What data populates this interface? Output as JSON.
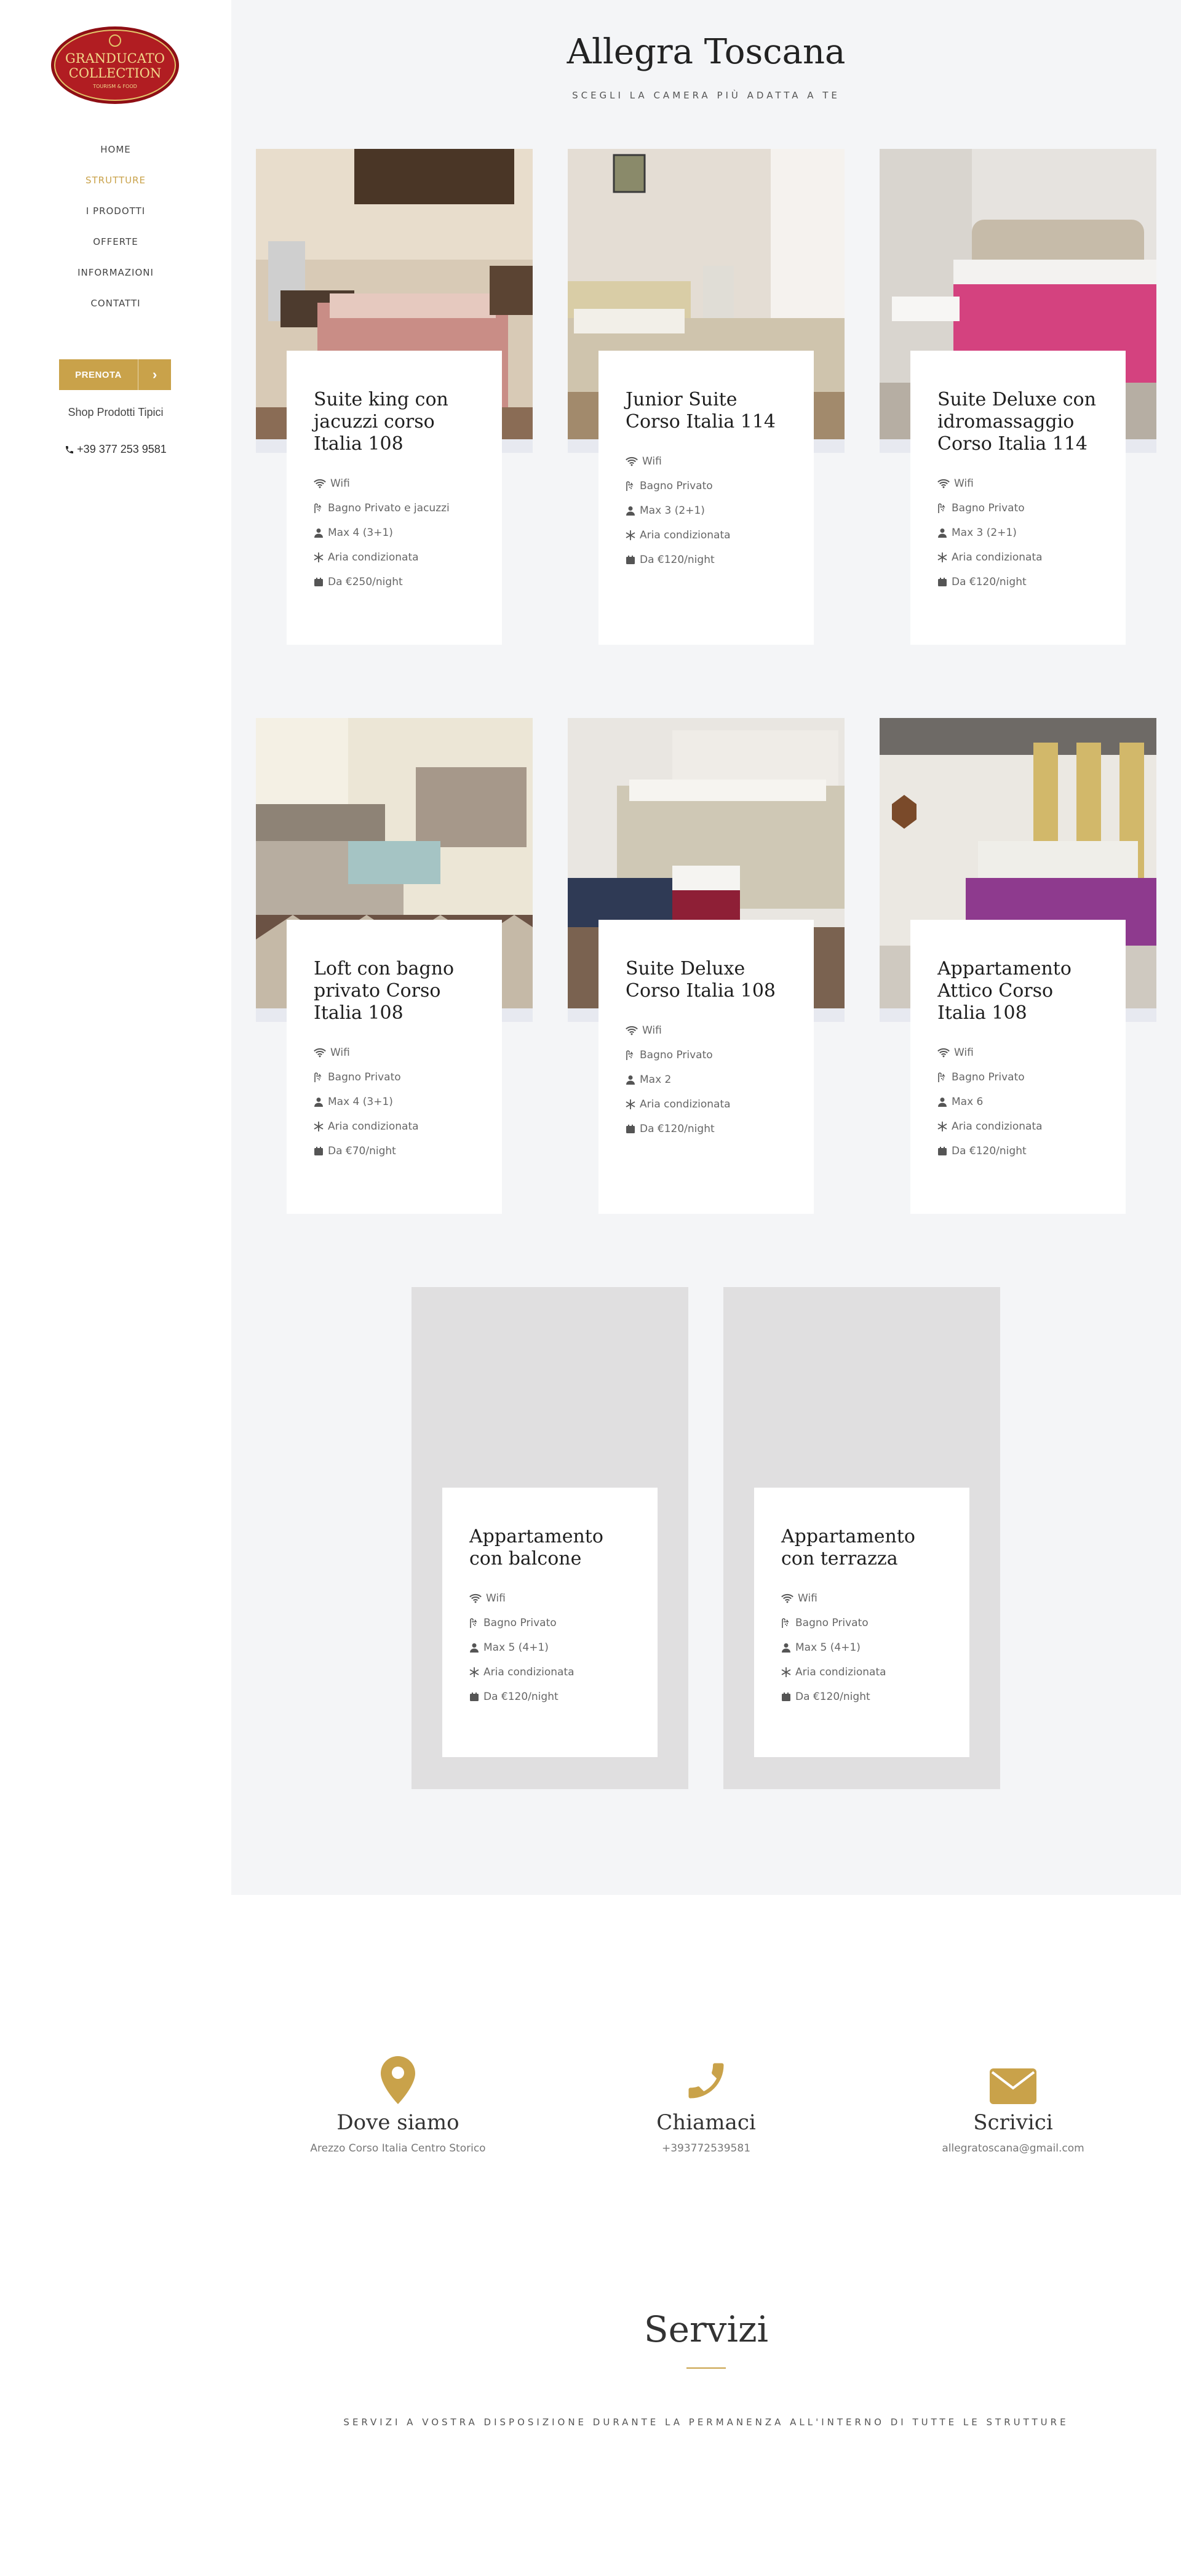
{
  "logo": {
    "line1": "GRANDUCATO",
    "line2": "COLLECTION",
    "line3": "TOURISM & FOOD"
  },
  "nav": {
    "items": [
      {
        "label": "HOME"
      },
      {
        "label": "STRUTTURE",
        "active": true
      },
      {
        "label": "I PRODOTTI"
      },
      {
        "label": "OFFERTE"
      },
      {
        "label": "INFORMAZIONI"
      },
      {
        "label": "CONTATTI"
      }
    ]
  },
  "prenota": {
    "label": "PRENOTA",
    "arrow": "›"
  },
  "shop": {
    "label": "Shop Prodotti Tipici"
  },
  "phone": {
    "number": "+39 377 253 9581"
  },
  "page": {
    "title": "Allegra Toscana",
    "subtitle": "SCEGLI LA CAMERA PIÙ ADATTA A TE"
  },
  "rooms": [
    {
      "title": "Suite king con jacuzzi corso Italia 108",
      "wifi": "Wifi",
      "bath": "Bagno Privato e jacuzzi",
      "guests": "Max 4 (3+1)",
      "air": "Aria condizionata",
      "price": "Da €250/night"
    },
    {
      "title": "Junior Suite Corso Italia 114",
      "wifi": "Wifi",
      "bath": "Bagno Privato",
      "guests": "Max 3 (2+1)",
      "air": "Aria condizionata",
      "price": "Da €120/night"
    },
    {
      "title": "Suite Deluxe con idromassaggio Corso Italia 114",
      "wifi": "Wifi",
      "bath": "Bagno Privato",
      "guests": "Max 3 (2+1)",
      "air": "Aria condizionata",
      "price": "Da €120/night"
    },
    {
      "title": "Loft con bagno privato Corso Italia 108",
      "wifi": "Wifi",
      "bath": "Bagno Privato",
      "guests": "Max 4 (3+1)",
      "air": "Aria condizionata",
      "price": "Da €70/night"
    },
    {
      "title": "Suite Deluxe Corso Italia 108",
      "wifi": "Wifi",
      "bath": "Bagno Privato",
      "guests": "Max 2",
      "air": "Aria condizionata",
      "price": "Da €120/night"
    },
    {
      "title": "Appartamento Attico Corso Italia 108",
      "wifi": "Wifi",
      "bath": "Bagno Privato",
      "guests": "Max 6",
      "air": "Aria condizionata",
      "price": "Da €120/night"
    },
    {
      "title": "Appartamento con balcone",
      "wifi": "Wifi",
      "bath": "Bagno Privato",
      "guests": "Max 5 (4+1)",
      "air": "Aria condizionata",
      "price": "Da €120/night"
    },
    {
      "title": "Appartamento con terrazza",
      "wifi": "Wifi",
      "bath": "Bagno Privato",
      "guests": "Max 5 (4+1)",
      "air": "Aria condizionata",
      "price": "Da €120/night"
    }
  ],
  "contacts": [
    {
      "icon": "map-marker-icon",
      "title": "Dove siamo",
      "text": "Arezzo Corso Italia Centro Storico"
    },
    {
      "icon": "phone-icon",
      "title": "Chiamaci",
      "text": "+393772539581"
    },
    {
      "icon": "envelope-icon",
      "title": "Scrivici",
      "text": "allegratoscana@gmail.com"
    }
  ],
  "servizi": {
    "title": "Servizi",
    "subtitle": "SERVIZI A VOSTRA DISPOSIZIONE DURANTE LA PERMANENZA ALL'INTERNO DI TUTTE LE STRUTTURE"
  },
  "colors": {
    "accent": "#c9a24a",
    "main_bg": "#f4f5f7",
    "card_bg": "#e7e9f0",
    "logo_red": "#a3151c"
  }
}
